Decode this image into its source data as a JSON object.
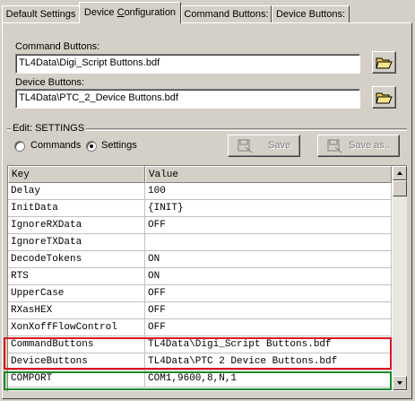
{
  "tabs": [
    {
      "label_pre": "Default Settings",
      "label_u": "",
      "label_post": ""
    },
    {
      "label_pre": "Device ",
      "label_u": "C",
      "label_post": "onfiguration"
    },
    {
      "label_pre": "Command Buttons:",
      "label_u": "",
      "label_post": ""
    },
    {
      "label_pre": "Device Buttons:",
      "label_u": "",
      "label_post": ""
    }
  ],
  "command_buttons": {
    "label": "Command Buttons:",
    "value": "TL4Data\\Digi_Script Buttons.bdf"
  },
  "device_buttons": {
    "label": "Device Buttons:",
    "value": "TL4Data\\PTC_2_Device Buttons.bdf"
  },
  "edit": {
    "title": "Edit: SETTINGS",
    "radio_commands": "Commands",
    "radio_settings": "Settings",
    "selected": "Settings",
    "save_label": "Save",
    "save_as_label": "Save as.."
  },
  "grid": {
    "headers": [
      "Key",
      "Value"
    ],
    "rows": [
      [
        "Delay",
        "100"
      ],
      [
        "InitData",
        "{INIT}"
      ],
      [
        "IgnoreRXData",
        "OFF"
      ],
      [
        "IgnoreTXData",
        ""
      ],
      [
        "DecodeTokens",
        "ON"
      ],
      [
        "RTS",
        "ON"
      ],
      [
        "UpperCase",
        "OFF"
      ],
      [
        "RXasHEX",
        "OFF"
      ],
      [
        "XonXoffFlowControl",
        "OFF"
      ],
      [
        "CommandButtons",
        "TL4Data\\Digi_Script Buttons.bdf"
      ],
      [
        "DeviceButtons",
        "TL4Data\\PTC 2 Device Buttons.bdf"
      ],
      [
        "COMPORT",
        "COM1,9600,8,N,1"
      ]
    ]
  },
  "icons": {
    "folder": "folder-open-icon",
    "save": "save-disk-icon",
    "save_as": "save-as-disk-icon"
  },
  "colors": {
    "highlight_red": "#e0141e",
    "highlight_green": "#1a8a2a"
  }
}
